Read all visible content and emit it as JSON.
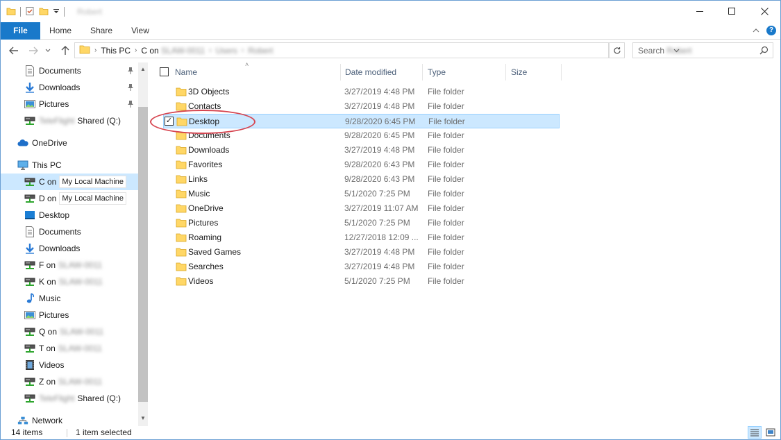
{
  "window": {
    "title": "Robert"
  },
  "ribbon": {
    "tabs": [
      {
        "label": "File"
      },
      {
        "label": "Home"
      },
      {
        "label": "Share"
      },
      {
        "label": "View"
      }
    ]
  },
  "address": {
    "crumbs": [
      "This PC",
      "C on",
      "SLAW-0011",
      "Users",
      "Robert"
    ]
  },
  "search": {
    "placeholder_prefix": "Search",
    "placeholder_name": "Robert"
  },
  "navpane": {
    "items": [
      {
        "label": "Documents",
        "icon": "documents-icon",
        "pinned": true
      },
      {
        "label": "Downloads",
        "icon": "download-arrow-icon",
        "pinned": true
      },
      {
        "label": "Pictures",
        "icon": "pictures-icon",
        "pinned": true
      },
      {
        "label": "Shared (Q:)",
        "blurred_prefix": "TeleFlight",
        "icon": "network-drive-icon"
      },
      {
        "label": "OneDrive",
        "icon": "cloud-icon"
      },
      {
        "label": "This PC",
        "icon": "computer-icon"
      },
      {
        "label": "C on",
        "tooltip": "My Local Machine",
        "icon": "network-drive-icon",
        "selected": true
      },
      {
        "label": "D on",
        "tooltip": "My Local Machine",
        "icon": "network-drive-icon"
      },
      {
        "label": "Desktop",
        "icon": "desktop-icon"
      },
      {
        "label": "Documents",
        "icon": "documents-icon"
      },
      {
        "label": "Downloads",
        "icon": "download-arrow-icon"
      },
      {
        "label": "F on",
        "blurred_suffix": "SLAW-0011",
        "icon": "network-drive-icon"
      },
      {
        "label": "K on",
        "blurred_suffix": "SLAW-0011",
        "icon": "network-drive-icon"
      },
      {
        "label": "Music",
        "icon": "music-note-icon"
      },
      {
        "label": "Pictures",
        "icon": "pictures-icon"
      },
      {
        "label": "Q on",
        "blurred_suffix": "SLAW-0011",
        "icon": "network-drive-icon"
      },
      {
        "label": "T on",
        "blurred_suffix": "SLAW-0011",
        "icon": "network-drive-icon"
      },
      {
        "label": "Videos",
        "icon": "film-icon"
      },
      {
        "label": "Z on",
        "blurred_suffix": "SLAW-0011",
        "icon": "network-drive-icon"
      },
      {
        "label": "Shared (Q:)",
        "blurred_prefix": "TeleFlight",
        "icon": "network-drive-icon"
      },
      {
        "label": "Network",
        "icon": "network-icon"
      }
    ]
  },
  "list": {
    "columns": [
      "Name",
      "Date modified",
      "Type",
      "Size"
    ],
    "rows": [
      {
        "name": "3D Objects",
        "date": "3/27/2019 4:48 PM",
        "type": "File folder"
      },
      {
        "name": "Contacts",
        "date": "3/27/2019 4:48 PM",
        "type": "File folder"
      },
      {
        "name": "Desktop",
        "date": "9/28/2020 6:45 PM",
        "type": "File folder",
        "selected": true
      },
      {
        "name": "Documents",
        "date": "9/28/2020 6:45 PM",
        "type": "File folder"
      },
      {
        "name": "Downloads",
        "date": "3/27/2019 4:48 PM",
        "type": "File folder"
      },
      {
        "name": "Favorites",
        "date": "9/28/2020 6:43 PM",
        "type": "File folder"
      },
      {
        "name": "Links",
        "date": "9/28/2020 6:43 PM",
        "type": "File folder"
      },
      {
        "name": "Music",
        "date": "5/1/2020 7:25 PM",
        "type": "File folder"
      },
      {
        "name": "OneDrive",
        "date": "3/27/2019 11:07 AM",
        "type": "File folder"
      },
      {
        "name": "Pictures",
        "date": "5/1/2020 7:25 PM",
        "type": "File folder"
      },
      {
        "name": "Roaming",
        "date": "12/27/2018 12:09 ...",
        "type": "File folder"
      },
      {
        "name": "Saved Games",
        "date": "3/27/2019 4:48 PM",
        "type": "File folder"
      },
      {
        "name": "Searches",
        "date": "3/27/2019 4:48 PM",
        "type": "File folder"
      },
      {
        "name": "Videos",
        "date": "5/1/2020 7:25 PM",
        "type": "File folder"
      }
    ]
  },
  "status": {
    "count": "14 items",
    "selection": "1 item selected"
  },
  "colors": {
    "accent": "#1979ca",
    "selection": "#cce8ff",
    "annotation": "#d64550",
    "folder": "#ffd766"
  }
}
